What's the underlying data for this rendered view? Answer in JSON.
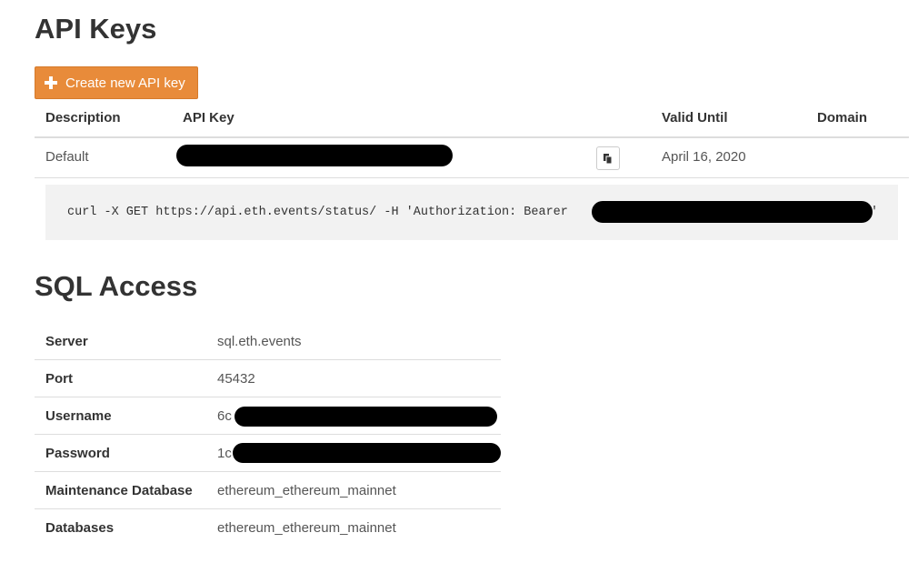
{
  "api_keys": {
    "title": "API Keys",
    "create_button_label": "Create new API key",
    "columns": [
      "Description",
      "API Key",
      "Valid Until",
      "Domain"
    ],
    "rows": [
      {
        "description": "Default",
        "valid_until": "April 16, 2020",
        "domain": ""
      }
    ],
    "curl_example": "curl -X GET https://api.eth.events/status/ -H 'Authorization: Bearer ",
    "curl_tail": "'"
  },
  "sql_access": {
    "title": "SQL Access",
    "rows": [
      {
        "label": "Server",
        "value": "sql.eth.events"
      },
      {
        "label": "Port",
        "value": "45432"
      },
      {
        "label": "Username",
        "value": "6c"
      },
      {
        "label": "Password",
        "value": "1c"
      },
      {
        "label": "Maintenance Database",
        "value": "ethereum_ethereum_mainnet"
      },
      {
        "label": "Databases",
        "value": "ethereum_ethereum_mainnet"
      }
    ]
  },
  "colors": {
    "accent": "#e88b3a",
    "code_background": "#f2f2f2"
  },
  "icons": {
    "create_button": "plus-icon",
    "copy_button": "copy-icon"
  }
}
